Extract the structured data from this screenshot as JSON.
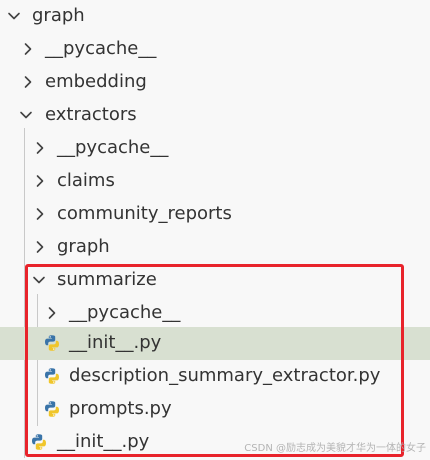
{
  "explorer": {
    "items": [
      {
        "label": "graph",
        "kind": "folder",
        "expanded": true,
        "depth": 0,
        "icon": "chevron-down-icon"
      },
      {
        "label": "__pycache__",
        "kind": "folder",
        "expanded": false,
        "depth": 1,
        "icon": "chevron-right-icon"
      },
      {
        "label": "embedding",
        "kind": "folder",
        "expanded": false,
        "depth": 1,
        "icon": "chevron-right-icon"
      },
      {
        "label": "extractors",
        "kind": "folder",
        "expanded": true,
        "depth": 1,
        "icon": "chevron-down-icon"
      },
      {
        "label": "__pycache__",
        "kind": "folder",
        "expanded": false,
        "depth": 2,
        "icon": "chevron-right-icon"
      },
      {
        "label": "claims",
        "kind": "folder",
        "expanded": false,
        "depth": 2,
        "icon": "chevron-right-icon"
      },
      {
        "label": "community_reports",
        "kind": "folder",
        "expanded": false,
        "depth": 2,
        "icon": "chevron-right-icon"
      },
      {
        "label": "graph",
        "kind": "folder",
        "expanded": false,
        "depth": 2,
        "icon": "chevron-right-icon"
      },
      {
        "label": "summarize",
        "kind": "folder",
        "expanded": true,
        "depth": 2,
        "icon": "chevron-down-icon"
      },
      {
        "label": "__pycache__",
        "kind": "folder",
        "expanded": false,
        "depth": 3,
        "icon": "chevron-right-icon"
      },
      {
        "label": "__init__.py",
        "kind": "file",
        "selected": true,
        "depth": 3,
        "icon": "python-icon"
      },
      {
        "label": "description_summary_extractor.py",
        "kind": "file",
        "depth": 3,
        "icon": "python-icon"
      },
      {
        "label": "prompts.py",
        "kind": "file",
        "depth": 3,
        "icon": "python-icon"
      },
      {
        "label": "__init__.py",
        "kind": "file",
        "depth": 2,
        "icon": "python-icon"
      }
    ]
  },
  "watermark": "CSDN @励志成为美貌才华为一体的女子",
  "colors": {
    "highlight_border": "#e8232b",
    "selected_row": "#d8e0d1",
    "python_blue": "#3a74a8",
    "python_yellow": "#f0c62b"
  }
}
